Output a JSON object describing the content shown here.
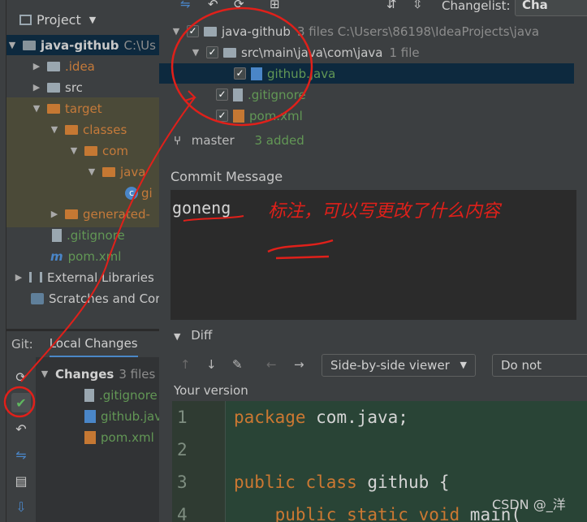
{
  "project": {
    "title": "Project",
    "tree": [
      {
        "label": "java-github",
        "suffix": "C:\\Us",
        "indent": 0,
        "expanded": true,
        "kind": "module"
      },
      {
        "label": ".idea",
        "indent": 1,
        "kind": "folder-gray",
        "collapsed": true
      },
      {
        "label": "src",
        "indent": 1,
        "kind": "folder-gray",
        "collapsed": true
      },
      {
        "label": "target",
        "indent": 1,
        "kind": "folder-orange",
        "expanded": true
      },
      {
        "label": "classes",
        "indent": 2,
        "kind": "folder-orange",
        "expanded": true
      },
      {
        "label": "com",
        "indent": 3,
        "kind": "folder-orange",
        "expanded": true
      },
      {
        "label": "java",
        "indent": 4,
        "kind": "folder-orange",
        "expanded": true
      },
      {
        "label": "gi",
        "indent": 5,
        "kind": "class"
      },
      {
        "label": "generated-",
        "indent": 2,
        "kind": "folder-orange",
        "collapsed": true
      },
      {
        "label": ".gitignore",
        "indent": 1,
        "kind": "gitignore"
      },
      {
        "label": "pom.xml",
        "indent": 1,
        "kind": "maven"
      },
      {
        "label": "External Libraries",
        "indent": 0,
        "kind": "libraries",
        "collapsed": true
      },
      {
        "label": "Scratches and Cor",
        "indent": 0,
        "kind": "scratches"
      }
    ]
  },
  "git": {
    "label": "Git:",
    "tab": "Local Changes",
    "changes_label": "Changes",
    "changes_count": "3 files",
    "files": [
      ".gitignore",
      "github.jav",
      "pom.xml"
    ]
  },
  "commit": {
    "changelist_label": "Changelist:",
    "changelist_value": "Cha",
    "tree": [
      {
        "label": "java-github",
        "detail": "3 files  C:\\Users\\86198\\IdeaProjects\\java"
      },
      {
        "label": "src\\main\\java\\com\\java",
        "detail": "1 file"
      },
      {
        "label": "github.java",
        "detail": ""
      },
      {
        "label": ".gitignore",
        "detail": ""
      },
      {
        "label": "pom.xml",
        "detail": ""
      }
    ],
    "branch": "master",
    "added": "3 added",
    "message_label": "Commit Message",
    "message": "goneng",
    "diff_label": "Diff",
    "viewer": "Side-by-side viewer",
    "ignore": "Do not",
    "your_version": "Your version"
  },
  "code": [
    {
      "n": "1",
      "parts": [
        [
          "kw",
          "package "
        ],
        [
          "txt",
          "com.java;"
        ]
      ]
    },
    {
      "n": "2",
      "parts": []
    },
    {
      "n": "3",
      "parts": [
        [
          "kw",
          "public class "
        ],
        [
          "txt",
          "github {"
        ]
      ]
    },
    {
      "n": "4",
      "parts": [
        [
          "kw",
          "    public static void "
        ],
        [
          "txt",
          "main("
        ]
      ]
    }
  ],
  "annotation": {
    "note": "标注，可以写更改了什么内容",
    "color": "#e0201a"
  },
  "watermark": "CSDN @_洋"
}
